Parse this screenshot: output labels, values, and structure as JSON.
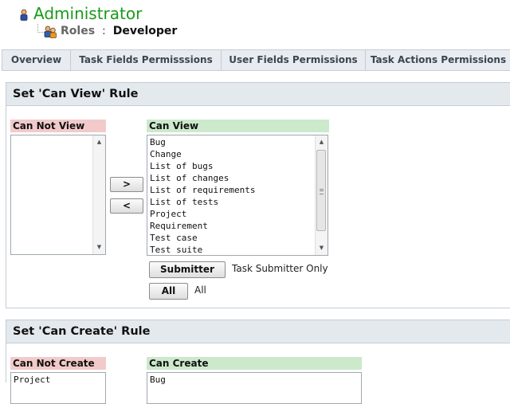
{
  "header": {
    "title": "Administrator",
    "roles_label": "Roles",
    "roles_separator": ":",
    "roles_value": "Developer"
  },
  "tabs": [
    {
      "label": "Overview"
    },
    {
      "label": "Task Fields Permisssions"
    },
    {
      "label": "User Fields Permissions"
    },
    {
      "label": "Task Actions Permissions"
    }
  ],
  "view_rule": {
    "title": "Set 'Can View' Rule",
    "can_not_label": "Can Not View",
    "can_not_items": [],
    "can_label": "Can View",
    "can_items": [
      "Bug",
      "Change",
      "List of bugs",
      "List of changes",
      "List of requirements",
      "List of tests",
      "Project",
      "Requirement",
      "Test case",
      "Test suite"
    ],
    "move_right_label": ">",
    "move_left_label": "<",
    "submitter_button": "Submitter",
    "submitter_desc": "Task Submitter Only",
    "all_button": "All",
    "all_desc": "All"
  },
  "create_rule": {
    "title": "Set 'Can Create' Rule",
    "can_not_label": "Can Not Create",
    "can_not_items": [
      "Project"
    ],
    "can_label": "Can Create",
    "can_items": [
      "Bug"
    ]
  },
  "colors": {
    "title_green": "#1a9a1a",
    "deny_header": "#f2caca",
    "allow_header": "#cce9cc",
    "panel_header": "#e4e9ee"
  }
}
